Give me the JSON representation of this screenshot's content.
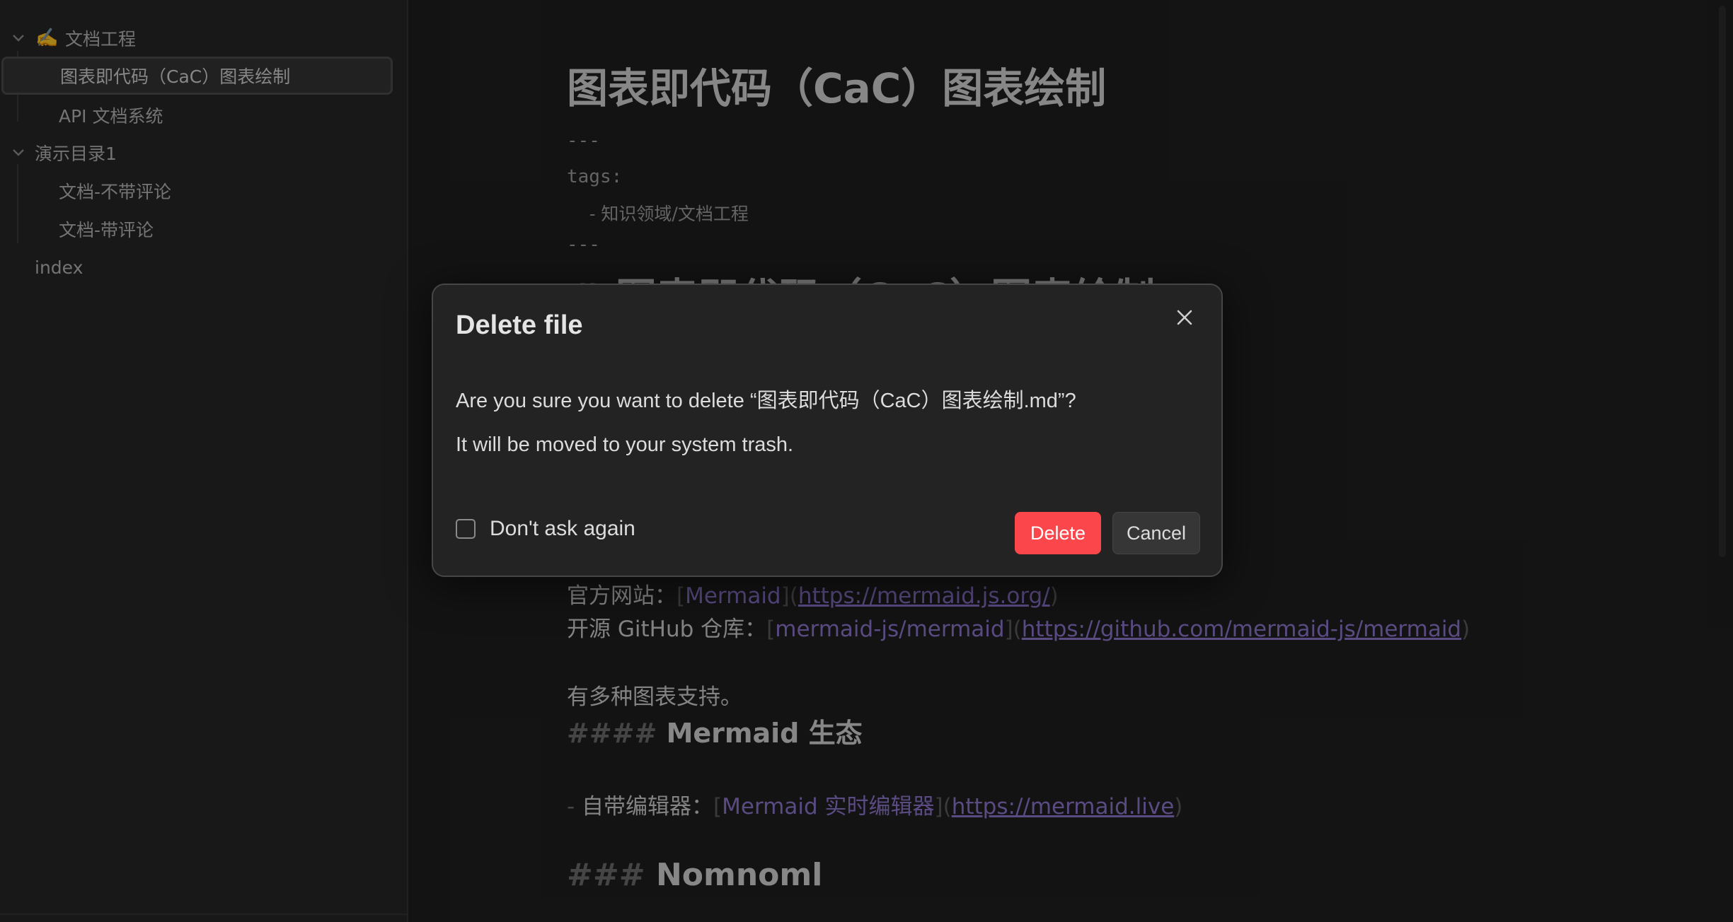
{
  "sidebar": {
    "items": [
      {
        "label": "文档工程",
        "emoji": "✍️",
        "expanded": true
      },
      {
        "label": "图表即代码（CaC）图表绘制",
        "active": true
      },
      {
        "label": "API 文档系统"
      },
      {
        "label": "演示目录1",
        "expanded": true
      },
      {
        "label": "文档-不带评论"
      },
      {
        "label": "文档-带评论"
      },
      {
        "label": "index"
      }
    ]
  },
  "editor": {
    "title": "图表即代码（CaC）图表绘制",
    "frontmatter_open": "---",
    "frontmatter_key": "tags:",
    "frontmatter_item": "- 知识领域/文档工程",
    "frontmatter_close": "---",
    "h1_hash": "#",
    "h1_partial": "图表即代码（CaC）图表绘制",
    "official_site": {
      "prefix": "官方网站：",
      "bracket_open": "[",
      "link_text": "Mermaid",
      "mid": "](",
      "url": "https://mermaid.js.org/",
      "close": ")"
    },
    "github_repo": {
      "prefix": "开源 GitHub 仓库：",
      "bracket_open": "[",
      "link_text": "mermaid-js/mermaid",
      "mid": "](",
      "url": "https://github.com/mermaid-js/mermaid",
      "close": ")"
    },
    "support_text": "有多种图表支持。",
    "h4_hash": "####",
    "h4_text": "Mermaid 生态",
    "list_item": {
      "dash": "-",
      "prefix": "自带编辑器：",
      "bracket_open": "[",
      "link_text": "Mermaid 实时编辑器",
      "mid": "](",
      "url": "https://mermaid.live",
      "close": ")"
    },
    "h3_hash": "###",
    "h3_text": "Nomnoml"
  },
  "dialog": {
    "title": "Delete file",
    "message": "Are you sure you want to delete “图表即代码（CaC）图表绘制.md”?",
    "submessage": "It will be moved to your system trash.",
    "checkbox_label": "Don't ask again",
    "checkbox_checked": false,
    "delete_label": "Delete",
    "cancel_label": "Cancel"
  },
  "colors": {
    "accent_delete": "#fb464c",
    "link": "#8a73c9",
    "background": "#1e1e1e",
    "sidebar": "#262626"
  }
}
